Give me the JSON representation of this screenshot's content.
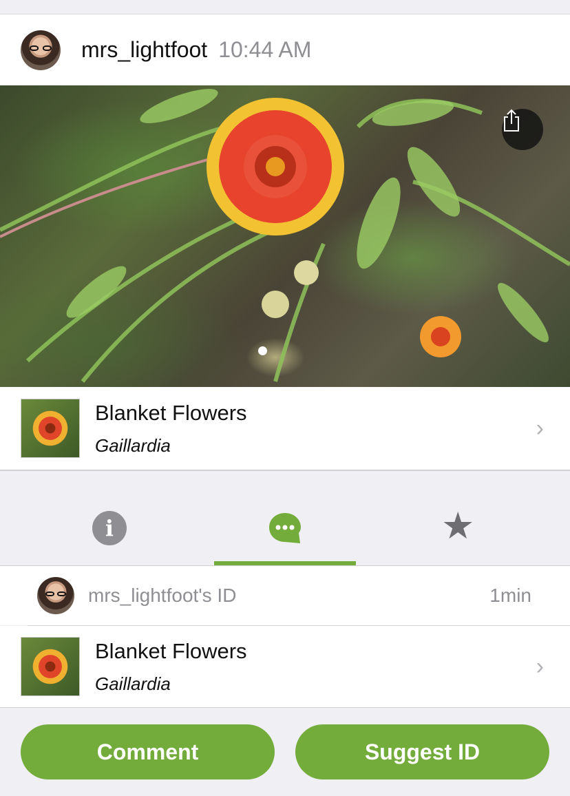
{
  "observation": {
    "user": "mrs_lightfoot",
    "time": "10:44 AM",
    "photo_icon": "share-icon"
  },
  "taxon": {
    "common_name": "Blanket Flowers",
    "scientific_name": "Gaillardia"
  },
  "tabs": {
    "info_icon": "info-icon",
    "activity_icon": "speech-bubble-icon",
    "favorite_icon": "star-icon",
    "selected": "activity"
  },
  "identification": {
    "label": "mrs_lightfoot's ID",
    "age": "1min",
    "common_name": "Blanket Flowers",
    "scientific_name": "Gaillardia"
  },
  "actions": {
    "comment": "Comment",
    "suggest_id": "Suggest ID"
  },
  "colors": {
    "accent": "#74ac3b",
    "background": "#efeff4",
    "muted_text": "#8e8e93"
  }
}
